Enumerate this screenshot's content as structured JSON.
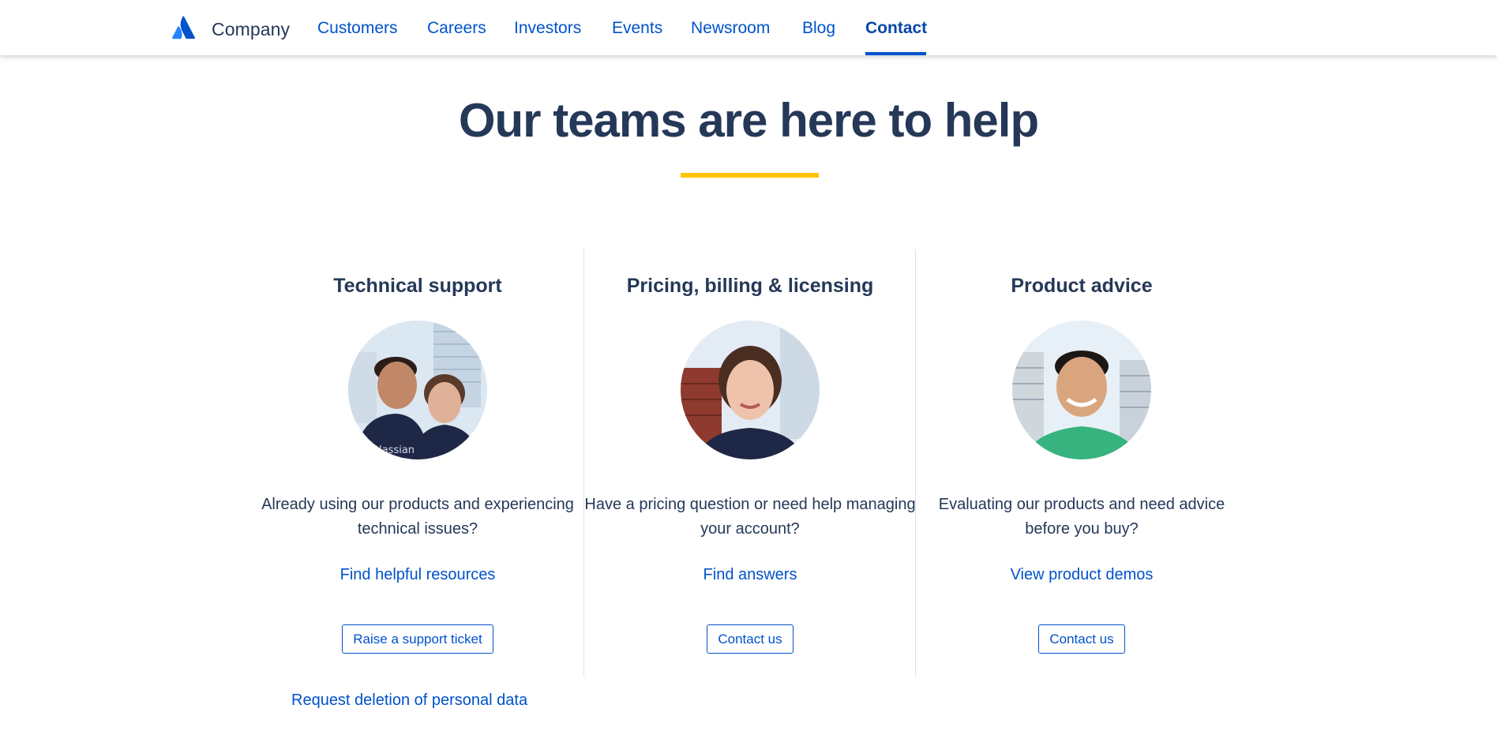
{
  "header": {
    "logo_icon": "atlassian-logo-icon",
    "brand_name": "Company",
    "nav": [
      {
        "label": "Customers"
      },
      {
        "label": "Careers"
      },
      {
        "label": "Investors"
      },
      {
        "label": "Events"
      },
      {
        "label": "Newsroom"
      },
      {
        "label": "Blog"
      },
      {
        "label": "Contact",
        "active": true
      }
    ]
  },
  "hero": {
    "title": "Our teams are here to help",
    "accent_color": "#ffc400"
  },
  "cards": [
    {
      "title": "Technical support",
      "photo": "support-team-photo",
      "description": "Already using our products and experiencing technical issues?",
      "link": "Find helpful resources",
      "button": "Raise a support ticket"
    },
    {
      "title": "Pricing, billing & licensing",
      "photo": "billing-team-photo",
      "description": "Have a pricing question or need help managing your account?",
      "link": "Find answers",
      "button": "Contact us"
    },
    {
      "title": "Product advice",
      "photo": "product-advice-photo",
      "description": "Evaluating our products and need advice before you buy?",
      "link": "View product demos",
      "button": "Contact us"
    }
  ],
  "footer_link": "Request deletion of personal data",
  "colors": {
    "link": "#0052cc",
    "heading": "#253858",
    "divider": "#dfe1e6"
  }
}
